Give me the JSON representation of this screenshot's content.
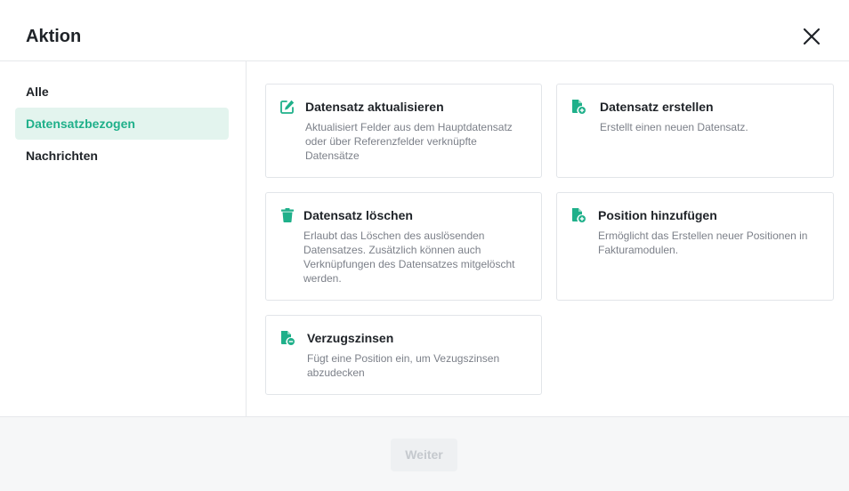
{
  "dialog": {
    "title": "Aktion"
  },
  "sidebar": {
    "items": [
      {
        "label": "Alle"
      },
      {
        "label": "Datensatzbezogen",
        "active": true
      },
      {
        "label": "Nachrichten"
      }
    ]
  },
  "cards": [
    {
      "icon": "edit-icon",
      "title": "Datensatz aktualisieren",
      "description": "Aktualisiert Felder aus dem Hauptdatensatz oder über Referenzfelder verknüpfte Datensätze"
    },
    {
      "icon": "file-add-icon",
      "title": "Datensatz erstellen",
      "description": "Erstellt einen neuen Datensatz."
    },
    {
      "icon": "trash-icon",
      "title": "Datensatz löschen",
      "description": "Erlaubt das Löschen des auslösenden Datensatzes. Zusätzlich können auch Verknüpfungen des Datensatzes mitgelöscht werden."
    },
    {
      "icon": "file-add-icon",
      "title": "Position hinzufügen",
      "description": "Ermöglicht das Erstellen neuer Positionen in Fakturamodulen."
    },
    {
      "icon": "file-add-icon",
      "title": "Verzugszinsen",
      "description": "Fügt eine Position ein, um Vezugszinsen abzudecken"
    }
  ],
  "footer": {
    "next_label": "Weiter",
    "next_disabled": true
  },
  "colors": {
    "accent": "#1fb08a",
    "active_bg": "#e3f4ee",
    "footer_bg": "#f6f7f8"
  }
}
